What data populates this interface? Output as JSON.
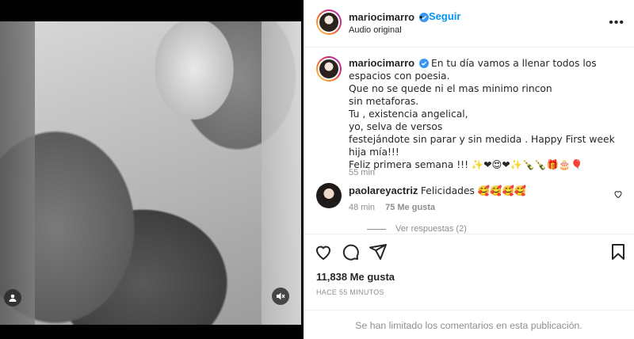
{
  "post": {
    "author": "mariocimarro",
    "follow_label": "Seguir",
    "audio": "Audio original",
    "more": "•••"
  },
  "caption": {
    "username": "mariocimarro",
    "text": "En tu día vamos a llenar todos los espacios con poesia.\nQue no se quede ni el mas minimo rincon\nsin metaforas.\nTu , existencia angelical,\nyo, selva de versos\nfestejándote sin parar y sin medida . Happy First week hija mía!!!\nFeliz primera semana !!! ✨❤😍❤✨🍾🍾🎁🎂🎈",
    "time": "55 min"
  },
  "comment": {
    "username": "paolareyactriz",
    "text": "Felicidades 🥰🥰🥰🥰",
    "time": "48 min",
    "likes": "75 Me gusta",
    "replies": "Ver respuestas (2)"
  },
  "stats": {
    "likes": "11,838 Me gusta",
    "posted": "HACE 55 MINUTOS"
  },
  "footer": {
    "limited": "Se han limitado los comentarios en esta publicación."
  },
  "colors": {
    "accent": "#0095f6",
    "verified": "#3897f0"
  }
}
